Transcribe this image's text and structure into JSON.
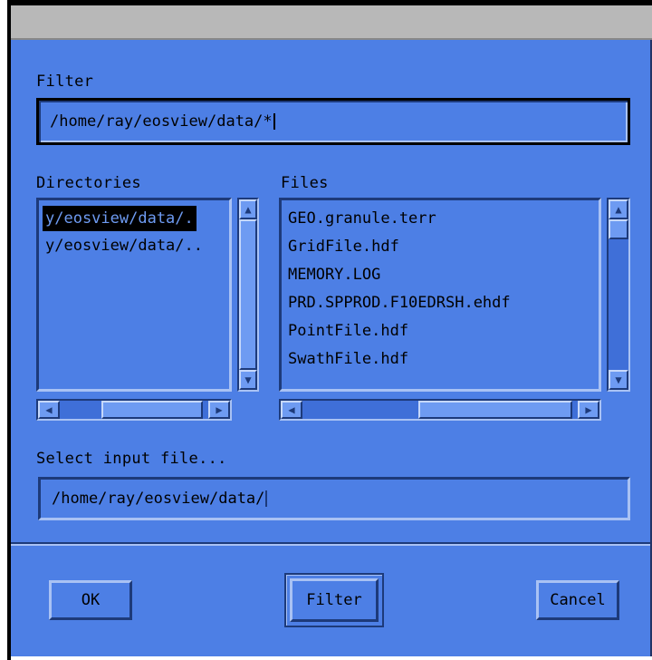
{
  "dialog": {
    "filter_label": "Filter",
    "filter_value": "/home/ray/eosview/data/*",
    "directories_label": "Directories",
    "files_label": "Files",
    "directories": [
      {
        "label": "y/eosview/data/.",
        "selected": true
      },
      {
        "label": "y/eosview/data/..",
        "selected": false
      }
    ],
    "files": [
      "GEO.granule.terr",
      "GridFile.hdf",
      "MEMORY.LOG",
      "PRD.SPPROD.F10EDRSH.ehdf",
      "PointFile.hdf",
      "SwathFile.hdf"
    ],
    "selection_label": "Select input file...",
    "selection_value": "/home/ray/eosview/data/",
    "buttons": {
      "ok": "OK",
      "filter": "Filter",
      "cancel": "Cancel"
    }
  },
  "colors": {
    "dialog_background": "#4d7fe5",
    "selected_background": "#000000",
    "title_bar": "#b8b8b8"
  },
  "icons": {
    "arrow_up": "▲",
    "arrow_down": "▼",
    "arrow_left": "◀",
    "arrow_right": "▶"
  }
}
